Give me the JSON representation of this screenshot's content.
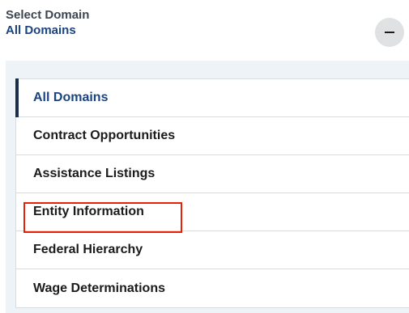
{
  "header": {
    "label": "Select Domain",
    "value": "All Domains",
    "toggle_icon": "minus-icon"
  },
  "domains": {
    "items": [
      {
        "label": "All Domains",
        "active": true
      },
      {
        "label": "Contract Opportunities",
        "active": false
      },
      {
        "label": "Assistance Listings",
        "active": false
      },
      {
        "label": "Entity Information",
        "active": false,
        "highlighted": true
      },
      {
        "label": "Federal Hierarchy",
        "active": false
      },
      {
        "label": "Wage Determinations",
        "active": false
      }
    ]
  },
  "colors": {
    "label_text": "#3d4551",
    "value_text": "#1a4480",
    "panel_background": "#eef3f8",
    "active_indicator": "#1a2e4a",
    "highlight_border": "#e52207",
    "toggle_background": "#dfe1e2"
  }
}
